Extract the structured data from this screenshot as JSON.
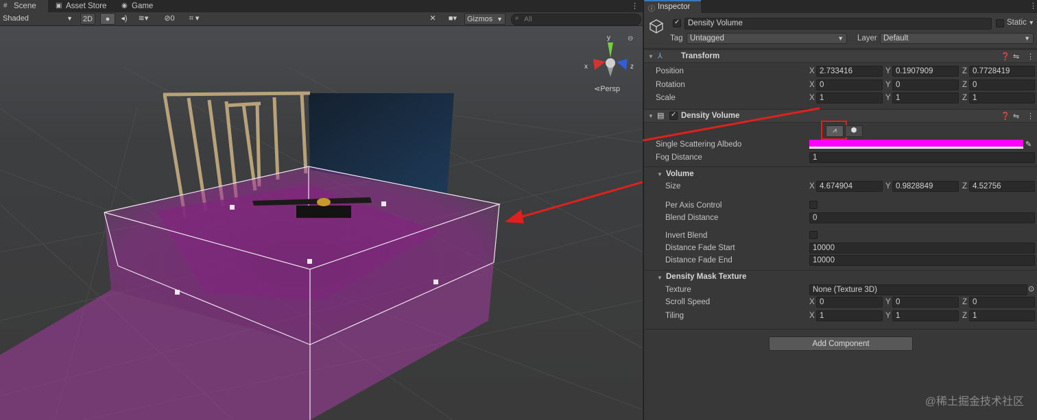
{
  "scene": {
    "tabs": [
      {
        "label": "Scene",
        "icon": "grid-icon"
      },
      {
        "label": "Asset Store",
        "icon": "store-icon"
      },
      {
        "label": "Game",
        "icon": "gamepad-icon"
      }
    ],
    "toolbar": {
      "draw_mode": "Shaded",
      "mode_2d": "2D",
      "hidden_count": "0",
      "gizmos": "Gizmos",
      "search_placeholder": "All"
    },
    "gizmo": {
      "y": "y",
      "x": "x",
      "z": "z",
      "persp": "Persp"
    }
  },
  "inspector": {
    "tab_label": "Inspector",
    "object": {
      "name": "Density Volume",
      "static_label": "Static",
      "tag_label": "Tag",
      "tag_value": "Untagged",
      "layer_label": "Layer",
      "layer_value": "Default"
    },
    "transform": {
      "title": "Transform",
      "rows": [
        {
          "label": "Position",
          "x": "2.733416",
          "y": "0.1907909",
          "z": "0.7728419"
        },
        {
          "label": "Rotation",
          "x": "0",
          "y": "0",
          "z": "0"
        },
        {
          "label": "Scale",
          "x": "1",
          "y": "1",
          "z": "1"
        }
      ]
    },
    "density_volume": {
      "title": "Density Volume",
      "albedo_label": "Single Scattering Albedo",
      "albedo_color": "#ff00ff",
      "fog_distance_label": "Fog Distance",
      "fog_distance": "1",
      "volume_title": "Volume",
      "size_label": "Size",
      "size": {
        "x": "4.674904",
        "y": "0.9828849",
        "z": "4.52756"
      },
      "per_axis_label": "Per Axis Control",
      "blend_distance_label": "Blend Distance",
      "blend_distance": "0",
      "invert_blend_label": "Invert Blend",
      "fade_start_label": "Distance Fade Start",
      "fade_start": "10000",
      "fade_end_label": "Distance Fade End",
      "fade_end": "10000",
      "mask_title": "Density Mask Texture",
      "texture_label": "Texture",
      "texture_value": "None (Texture 3D)",
      "scroll_label": "Scroll Speed",
      "scroll": {
        "x": "0",
        "y": "0",
        "z": "0"
      },
      "tiling_label": "Tiling",
      "tiling": {
        "x": "1",
        "y": "1",
        "z": "1"
      }
    },
    "axes": {
      "x": "X",
      "y": "Y",
      "z": "Z"
    },
    "add_component": "Add Component"
  },
  "annotation": {
    "highlight_color": "#e0201c"
  },
  "watermark": "@稀土掘金技术社区"
}
